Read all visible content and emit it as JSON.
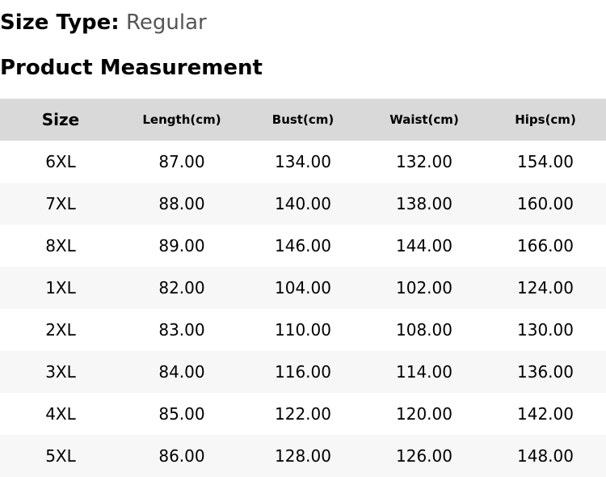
{
  "size_type": {
    "label": "Size Type:",
    "value": "Regular"
  },
  "section_title": "Product Measurement",
  "table": {
    "headers": [
      "Size",
      "Length(cm)",
      "Bust(cm)",
      "Waist(cm)",
      "Hips(cm)"
    ],
    "rows": [
      [
        "6XL",
        "87.00",
        "134.00",
        "132.00",
        "154.00"
      ],
      [
        "7XL",
        "88.00",
        "140.00",
        "138.00",
        "160.00"
      ],
      [
        "8XL",
        "89.00",
        "146.00",
        "144.00",
        "166.00"
      ],
      [
        "1XL",
        "82.00",
        "104.00",
        "102.00",
        "124.00"
      ],
      [
        "2XL",
        "83.00",
        "110.00",
        "108.00",
        "130.00"
      ],
      [
        "3XL",
        "84.00",
        "116.00",
        "114.00",
        "136.00"
      ],
      [
        "4XL",
        "85.00",
        "122.00",
        "120.00",
        "142.00"
      ],
      [
        "5XL",
        "86.00",
        "128.00",
        "126.00",
        "148.00"
      ]
    ]
  },
  "colors": {
    "header_bg": "#d9d9d9",
    "stripe_bg": "#f7f7f7",
    "value_gray": "#555555"
  }
}
